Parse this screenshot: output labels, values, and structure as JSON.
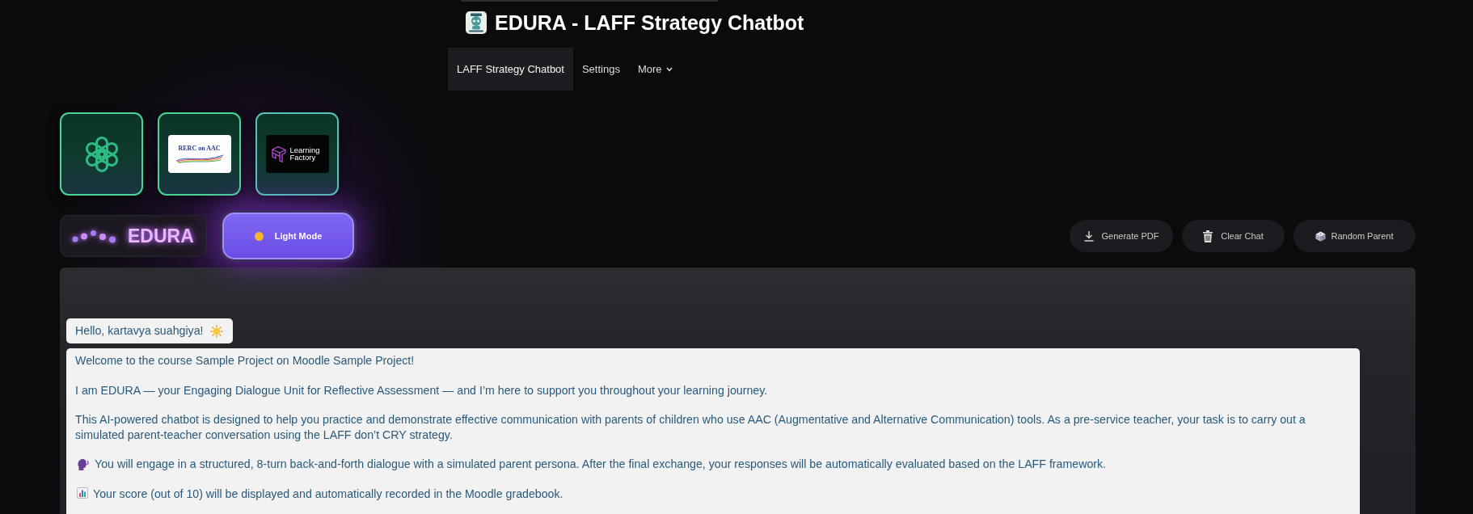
{
  "header": {
    "title": "EDURA - LAFF Strategy Chatbot"
  },
  "nav": [
    {
      "label": "LAFF Strategy Chatbot",
      "kind": "link",
      "selected": true
    },
    {
      "label": "Settings",
      "kind": "link",
      "selected": false
    },
    {
      "label": "More",
      "kind": "menu",
      "selected": false
    }
  ],
  "partner_logos": [
    {
      "kind": "knot"
    },
    {
      "kind": "rerc",
      "text": "RERC on AAC"
    },
    {
      "kind": "factory",
      "text": "Learning Factory"
    }
  ],
  "brand": {
    "name": "EDURA"
  },
  "theme_button": {
    "label": "Light Mode"
  },
  "actions": [
    {
      "kind": "download",
      "label": "Generate PDF"
    },
    {
      "kind": "delete",
      "label": "Clear Chat"
    },
    {
      "kind": "random",
      "label": "Random Parent"
    }
  ],
  "chat": {
    "messages": [
      {
        "kind": "greeting",
        "text": "Hello, kartavya suahgiya!"
      },
      {
        "kind": "bot",
        "paragraphs": [
          {
            "kind": "plain",
            "text": "Welcome to the course Sample Project on Moodle Sample Project!"
          },
          {
            "kind": "plain",
            "text": "I am EDURA — your Engaging Dialogue Unit for Reflective Assessment — and I’m here to support you throughout your learning journey."
          },
          {
            "kind": "plain",
            "text": "This AI-powered chatbot is designed to help you practice and demonstrate effective communication with parents of children who use AAC (Augmentative and Alternative Communication) tools. As a pre-service teacher, your task is to carry out a simulated parent-teacher conversation using the LAFF don’t CRY strategy."
          },
          {
            "kind": "speaking",
            "text": "You will engage in a structured, 8-turn back-and-forth dialogue with a simulated parent persona. After the final exchange, your responses will be automatically evaluated based on the LAFF framework."
          },
          {
            "kind": "stats",
            "text": "Your score (out of 10) will be displayed and automatically recorded in the Moodle gradebook."
          }
        ]
      }
    ]
  }
}
